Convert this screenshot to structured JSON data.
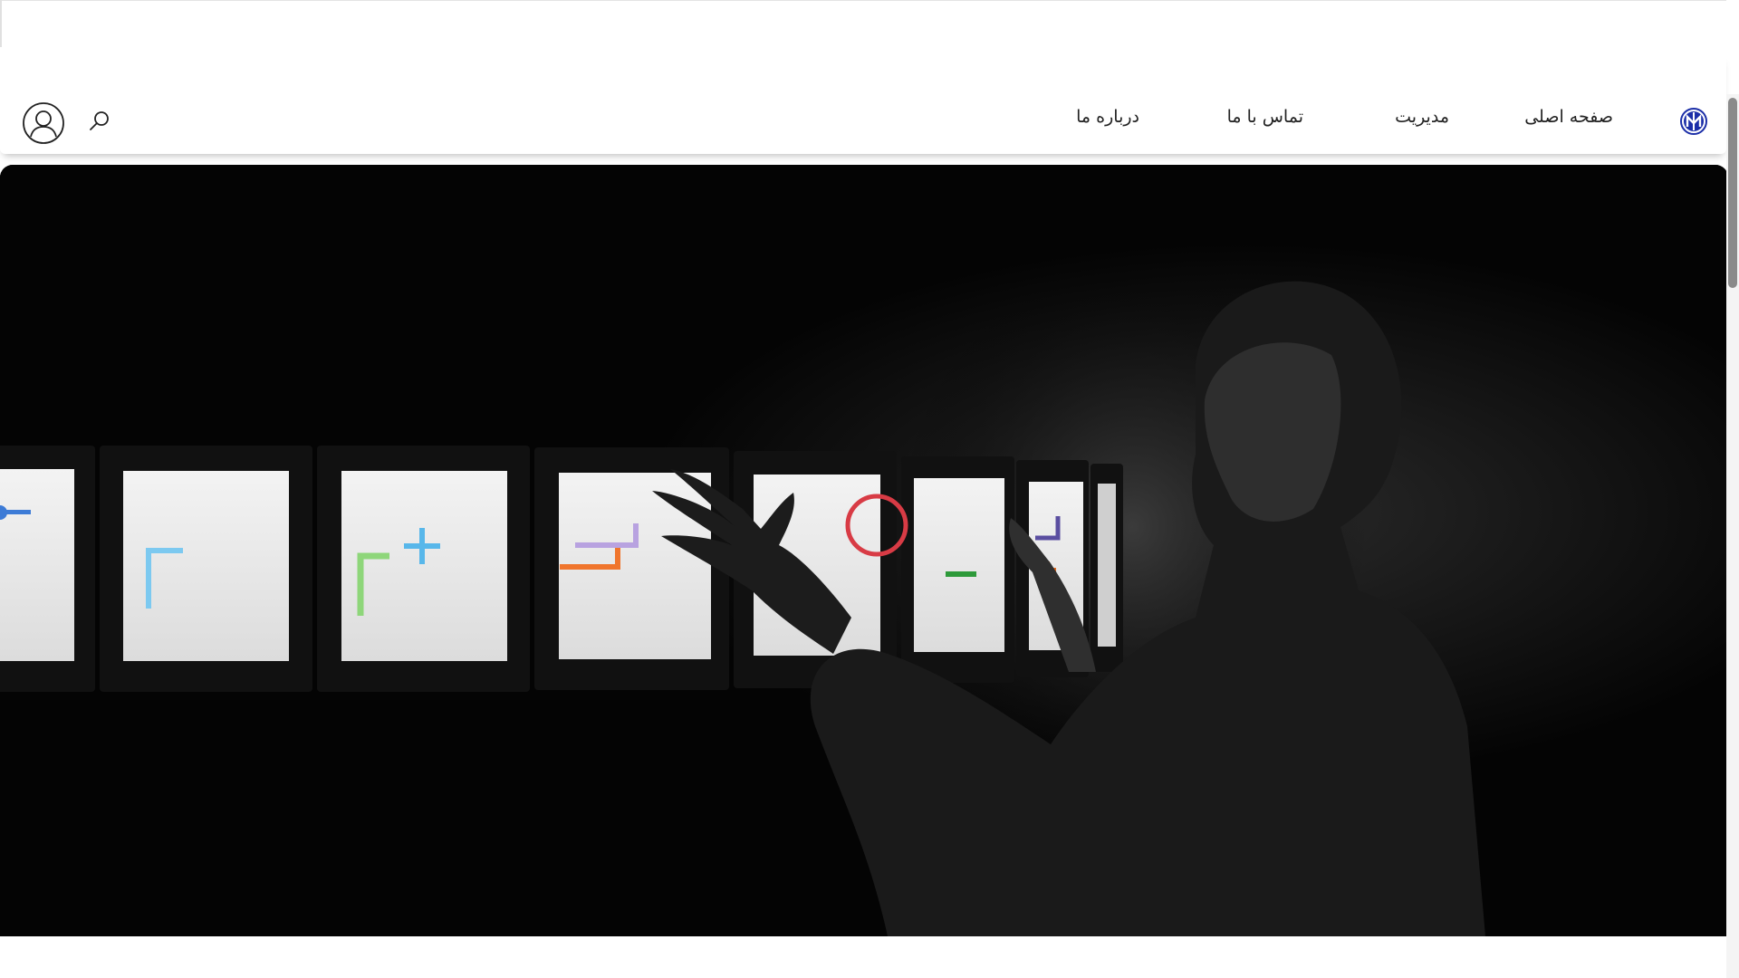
{
  "nav": {
    "items": [
      {
        "label": "صفحه اصلی"
      },
      {
        "label": "مدیریت"
      },
      {
        "label": "تماس با ما"
      },
      {
        "label": "درباره ما"
      }
    ]
  },
  "icons": {
    "logo": "university-logo-icon",
    "search": "search-icon",
    "account": "user-account-icon"
  },
  "colors": {
    "logo_blue": "#1c2fa8",
    "hero_bg": "#040404"
  }
}
